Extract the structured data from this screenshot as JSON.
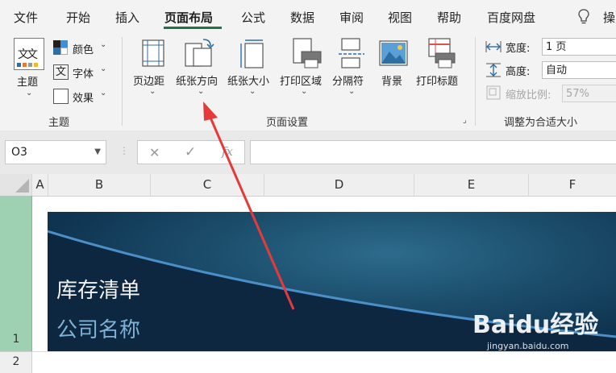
{
  "tabs": [
    "文件",
    "开始",
    "插入",
    "页面布局",
    "公式",
    "数据",
    "审阅",
    "视图",
    "帮助",
    "百度网盘",
    "操"
  ],
  "ribbon": {
    "theme_group": {
      "theme_label": "主题",
      "colors_label": "颜色",
      "fonts_label": "字体",
      "effects_label": "效果",
      "group_label": "主题",
      "theme_icon_text": "文文"
    },
    "page_setup": {
      "margins_label": "页边距",
      "orientation_label": "纸张方向",
      "size_label": "纸张大小",
      "print_area_label": "打印区域",
      "breaks_label": "分隔符",
      "background_label": "背景",
      "print_titles_label": "打印标题",
      "group_label": "页面设置"
    },
    "scale_to_fit": {
      "width_label": "宽度:",
      "width_value": "1 页",
      "height_label": "高度:",
      "height_value": "自动",
      "scale_label": "缩放比例:",
      "scale_value": "57%",
      "group_label": "调整为合适大小"
    }
  },
  "formula_bar": {
    "name_box": "O3",
    "fx": "fx",
    "formula": ""
  },
  "grid": {
    "columns": [
      "A",
      "B",
      "C",
      "D",
      "E",
      "F"
    ],
    "rows": [
      "1",
      "2"
    ]
  },
  "banner": {
    "title": "库存清单",
    "subtitle": "公司名称"
  },
  "watermark": {
    "text": "Baidu经验",
    "url": "jingyan.baidu.com"
  }
}
